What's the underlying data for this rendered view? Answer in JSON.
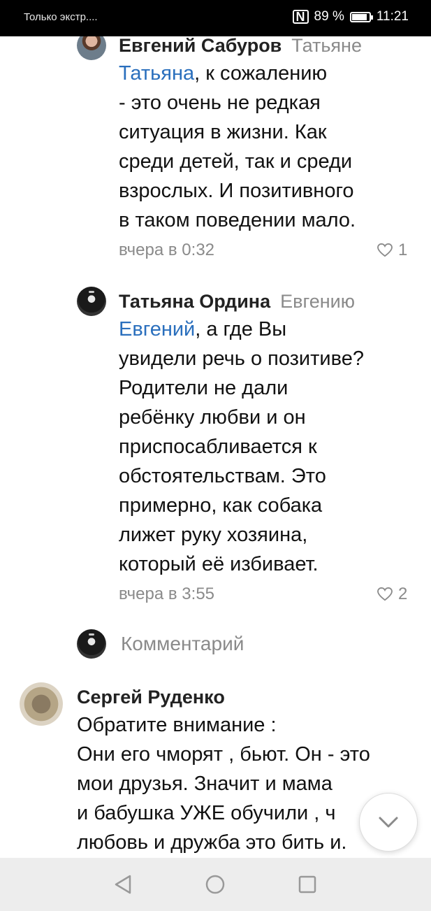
{
  "status_bar": {
    "carrier": "Только экстр....",
    "battery_percent": "89 %",
    "time": "11:21"
  },
  "comments": [
    {
      "author": "Евгений Сабуров",
      "reply_to": "Татьяне",
      "mention": "Татьяна",
      "text_rest": ", к сожалению\n- это очень не редкая\nситуация в жизни. Как\nсреди детей, так и среди\nвзрослых. И позитивного\nв таком поведении мало.",
      "time": "вчера в 0:32",
      "likes": "1"
    },
    {
      "author": "Татьяна Ордина",
      "reply_to": "Евгению",
      "mention": "Евгений",
      "text_rest": ", а где Вы\nувидели речь о позитиве?\nРодители не дали\nребёнку любви и он\nприспосабливается к\nобстоятельствам. Это\nпримерно, как собака\nлижет руку хозяина,\nкоторый её избивает.",
      "time": "вчера в 3:55",
      "likes": "2"
    },
    {
      "author": "Сергей Руденко",
      "text": "Обратите внимание :\nОни его чморят , бьют. Он - это\nмои друзья. Значит и мама\nи бабушка УЖЕ обучили , ч\nлюбовь и дружба это бить и."
    }
  ],
  "reply_box": {
    "placeholder": "Комментарий"
  }
}
